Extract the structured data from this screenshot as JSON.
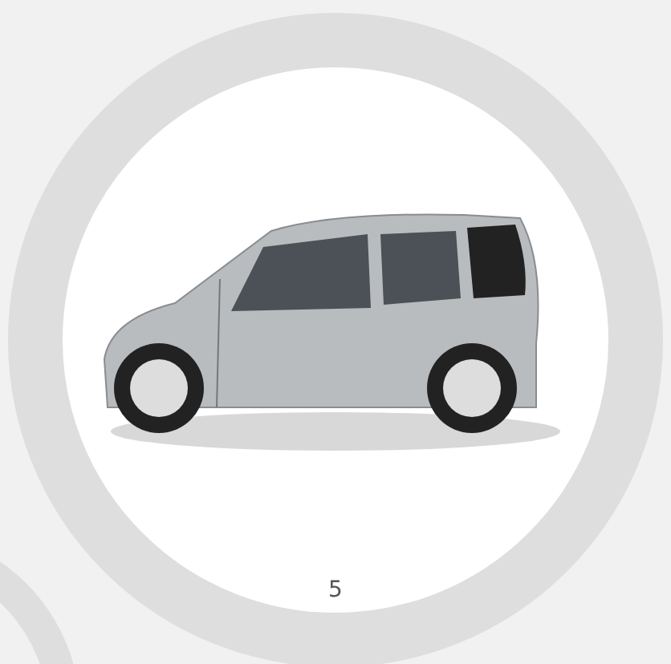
{
  "slide": {
    "number": "5"
  }
}
